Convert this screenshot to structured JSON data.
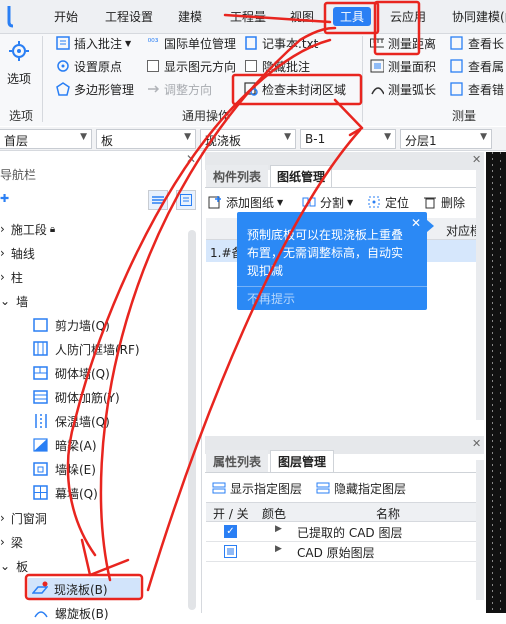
{
  "ribbon": {
    "tabs": [
      {
        "label": "开始"
      },
      {
        "label": "工程设置"
      },
      {
        "label": "建模"
      },
      {
        "label": "工程量"
      },
      {
        "label": "视图"
      },
      {
        "label": "工具",
        "active": true
      },
      {
        "label": "云应用"
      },
      {
        "label": "协同建模(内测"
      }
    ],
    "options_label": "选项",
    "options_group_label": "选项",
    "common_ops_group_label": "通用操作",
    "measure_group_label": "测量",
    "insert_note": "插入批注",
    "intl_unit": "国际单位管理",
    "notepad": "记事本.txt",
    "set_origin": "设置原点",
    "show_element_dir": "显示图元方向",
    "hide_note": "隐藏批注",
    "polygon_mgmt": "多边形管理",
    "adjust_dir": "调整方向",
    "check_unclosed": "检查未封闭区域",
    "measure_dist": "测量距离",
    "measure_area": "测量面积",
    "measure_arc": "测量弧长",
    "view_length": "查看长",
    "view_floor": "查看属",
    "view_error": "查看错"
  },
  "combos": {
    "floor": "首层",
    "board": "板",
    "cast_slab": "现浇板",
    "b_field": "B-1",
    "layer": "分层1"
  },
  "nav": {
    "title": "导航栏",
    "items": [
      {
        "label": "施工段"
      },
      {
        "label": "轴线"
      },
      {
        "label": "柱"
      },
      {
        "label": "墙"
      },
      {
        "label": "剪力墙(Q)"
      },
      {
        "label": "人防门框墙(RF)"
      },
      {
        "label": "砌体墙(Q)"
      },
      {
        "label": "砌体加筋(Y)"
      },
      {
        "label": "保温墙(Q)"
      },
      {
        "label": "暗梁(A)"
      },
      {
        "label": "墙垛(E)"
      },
      {
        "label": "幕墙(Q)"
      },
      {
        "label": "门窗洞"
      },
      {
        "label": "梁"
      },
      {
        "label": "板"
      },
      {
        "label": "现浇板(B)"
      },
      {
        "label": "螺旋板(B)"
      }
    ]
  },
  "components": {
    "tab_list": "构件列表",
    "tab_drawing": "图纸管理",
    "add_drawing": "添加图纸",
    "split": "分割",
    "locate": "定位",
    "delete": "删除",
    "col_floor": "对应楼",
    "row_1": "1.#备"
  },
  "tooltip": {
    "text": "预制底板可以在现浇板上重叠布置，无需调整标高，自动实现扣减",
    "dismiss": "不再提示"
  },
  "props": {
    "tab_attr": "属性列表",
    "tab_layer": "图层管理",
    "show_layer": "显示指定图层",
    "hide_layer": "隐藏指定图层",
    "col_onoff": "开 / 关",
    "col_color": "颜色",
    "col_name": "名称",
    "rows": [
      {
        "name": "已提取的 CAD 图层"
      },
      {
        "name": "CAD 原始图层"
      }
    ]
  },
  "colors": {
    "accent": "#2a7ff4",
    "annotation": "#e8251f",
    "tooltip_bg": "#2b89f5"
  }
}
